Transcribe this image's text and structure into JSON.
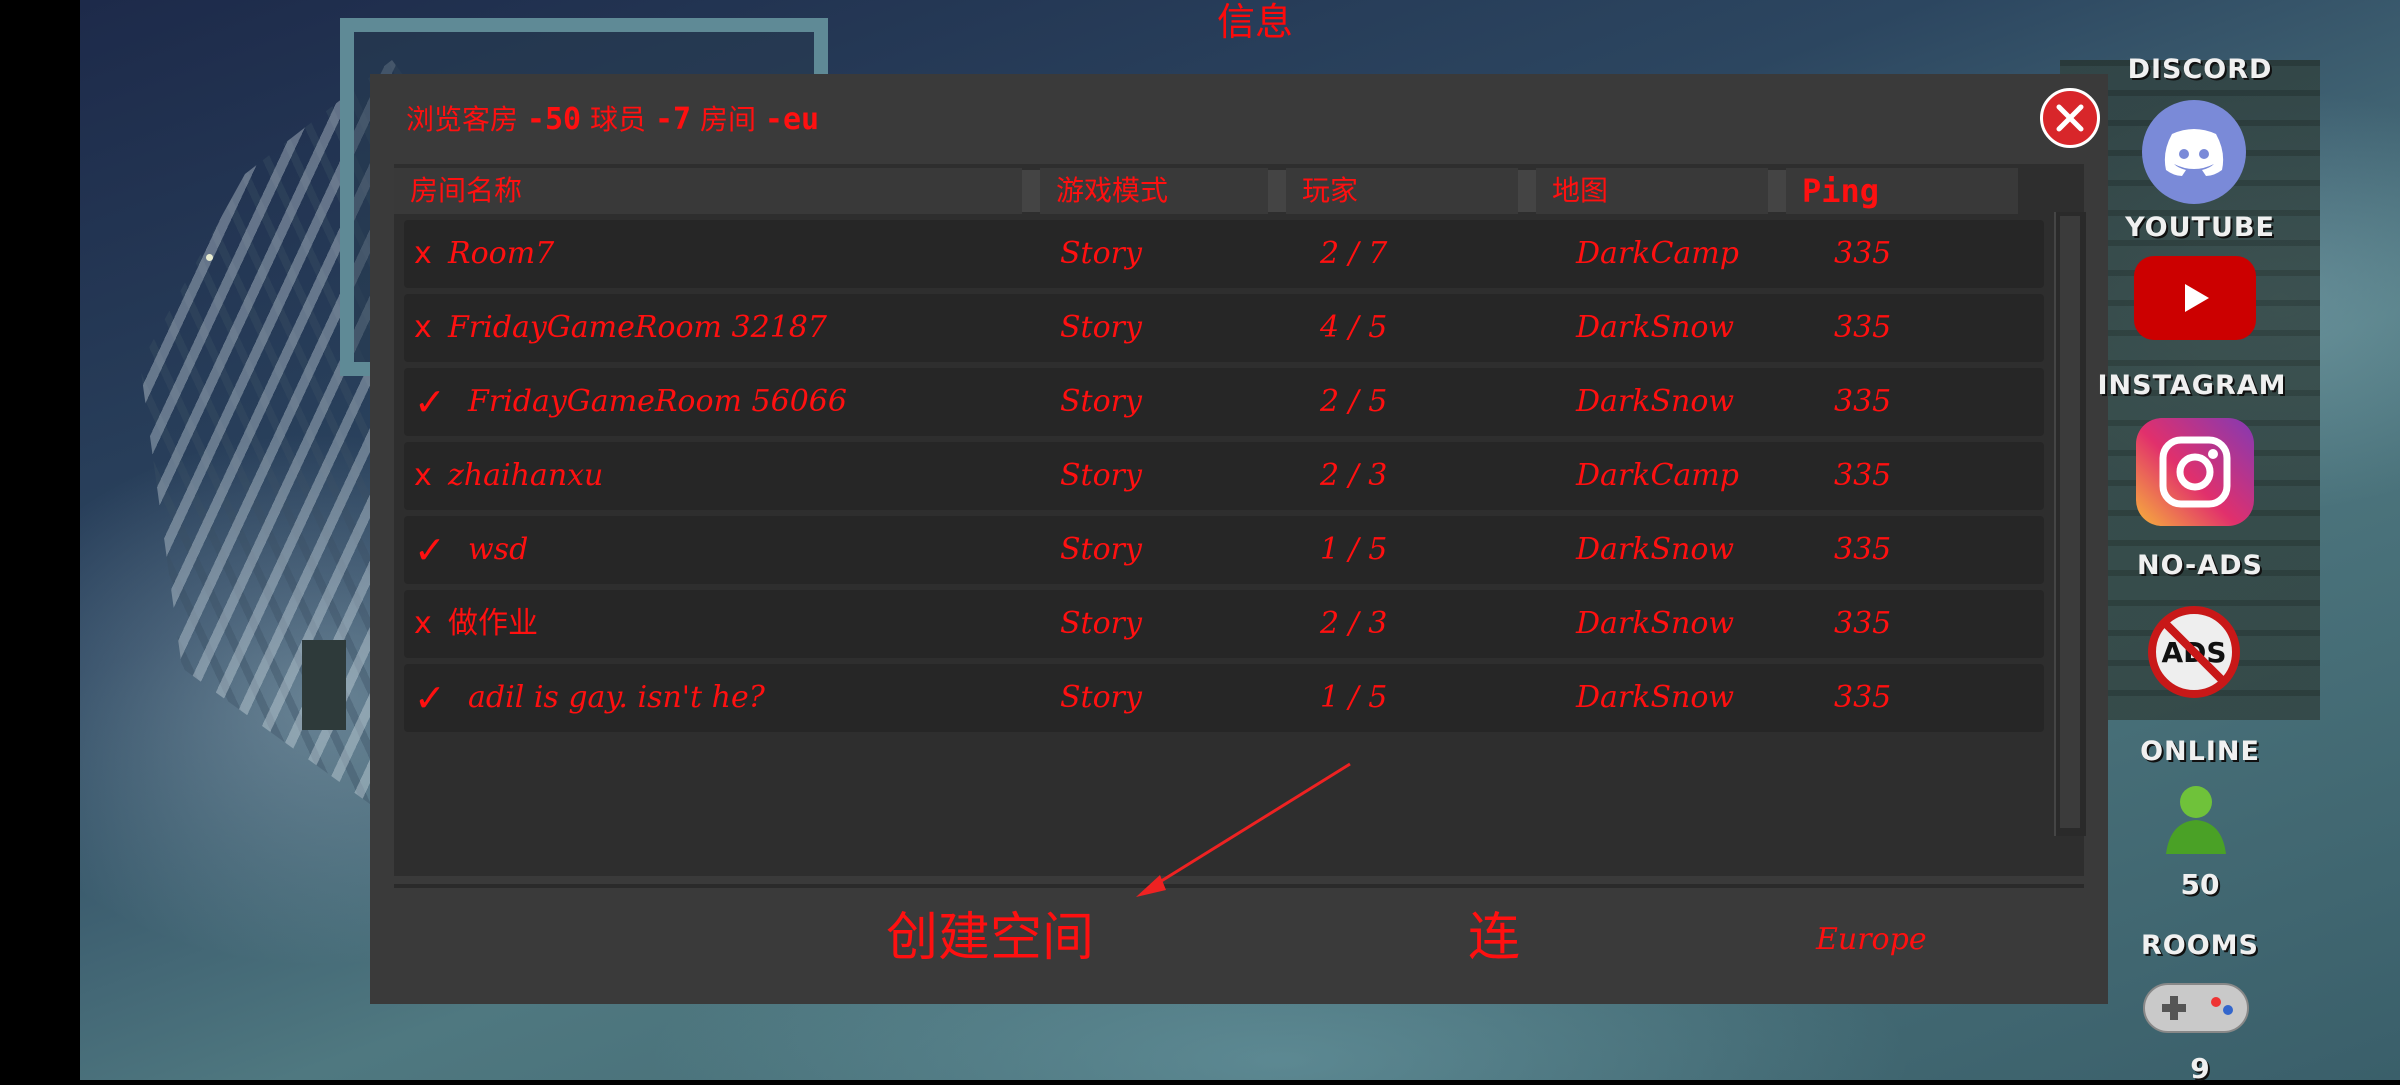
{
  "top_label": "信息",
  "panel": {
    "title_prefix": "浏览客房",
    "title_players": "-50",
    "title_mid": "球员",
    "title_rooms": "-7",
    "title_rooms_label": "房间",
    "title_region": "-eu"
  },
  "table": {
    "headers": [
      "房间名称",
      "游戏模式",
      "玩家",
      "地图",
      "Ping"
    ],
    "rows": [
      {
        "mark": "x",
        "name": "Room7",
        "mode": "Story",
        "players": "2 / 7",
        "map": "DarkCamp",
        "ping": "335"
      },
      {
        "mark": "x",
        "name": "FridayGameRoom 32187",
        "mode": "Story",
        "players": "4 / 5",
        "map": "DarkSnow",
        "ping": "335"
      },
      {
        "mark": "✓",
        "name": "FridayGameRoom 56066",
        "mode": "Story",
        "players": "2 / 5",
        "map": "DarkSnow",
        "ping": "335"
      },
      {
        "mark": "x",
        "name": "zhaihanxu",
        "mode": "Story",
        "players": "2 / 3",
        "map": "DarkCamp",
        "ping": "335"
      },
      {
        "mark": "✓",
        "name": "wsd",
        "mode": "Story",
        "players": "1 / 5",
        "map": "DarkSnow",
        "ping": "335"
      },
      {
        "mark": "x",
        "name": "做作业",
        "mode": "Story",
        "players": "2 / 3",
        "map": "DarkSnow",
        "ping": "335"
      },
      {
        "mark": "✓",
        "name": "adil is gay. isn't he?",
        "mode": "Story",
        "players": "1 / 5",
        "map": "DarkSnow",
        "ping": "335"
      }
    ]
  },
  "actions": {
    "create_label": "创建空间",
    "connect_label": "连",
    "region_label": "Europe"
  },
  "social": {
    "discord": "DISCORD",
    "youtube": "YOUTUBE",
    "instagram": "INSTAGRAM",
    "noads": "NO-ADS",
    "noads_icon_text": "ADS",
    "online": "ONLINE",
    "online_count": "50",
    "rooms": "ROOMS",
    "rooms_count": "9"
  },
  "colors": {
    "accent_red": "#ff1010",
    "panel_bg": "#3a3a3a",
    "close_button": "#d8262a"
  },
  "icons": [
    "close-icon",
    "discord-icon",
    "youtube-icon",
    "instagram-icon",
    "no-ads-icon",
    "online-user-icon",
    "gamepad-icon",
    "check-icon"
  ]
}
